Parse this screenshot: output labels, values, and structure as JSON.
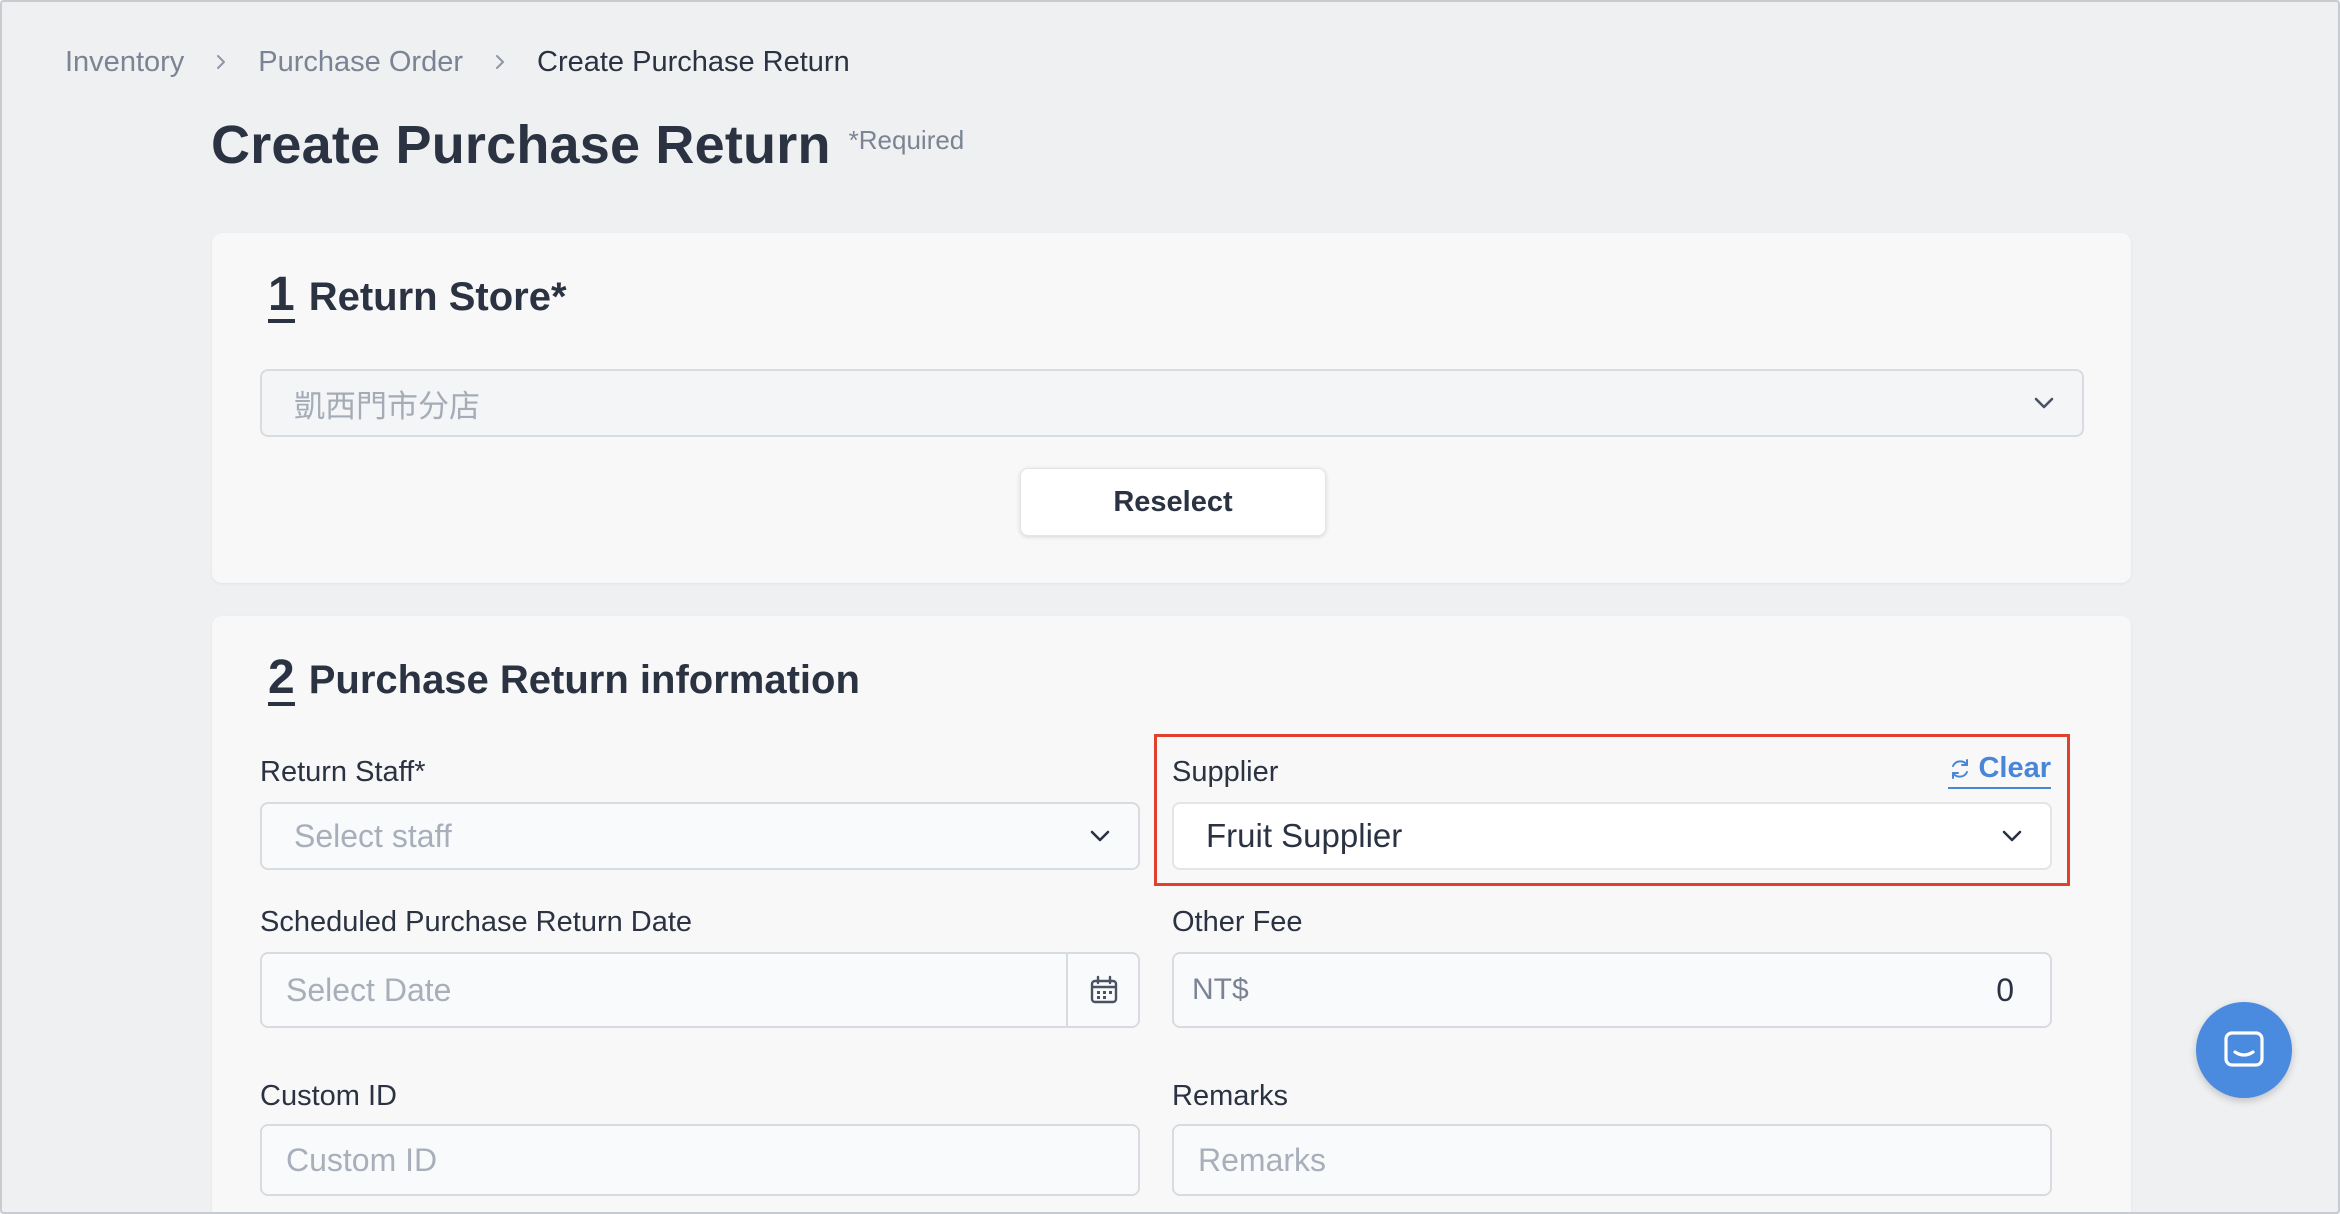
{
  "breadcrumb": {
    "items": [
      "Inventory",
      "Purchase Order",
      "Create Purchase Return"
    ]
  },
  "header": {
    "title": "Create Purchase Return",
    "required_note": "*Required"
  },
  "section1": {
    "number": "1",
    "title": "Return Store*",
    "store_select": {
      "value": "凱西門市分店"
    },
    "reselect_label": "Reselect"
  },
  "section2": {
    "number": "2",
    "title": "Purchase Return information",
    "return_staff": {
      "label": "Return Staff*",
      "placeholder": "Select staff"
    },
    "supplier": {
      "label": "Supplier",
      "clear_label": "Clear",
      "value": "Fruit Supplier"
    },
    "scheduled_date": {
      "label": "Scheduled Purchase Return Date",
      "placeholder": "Select Date"
    },
    "other_fee": {
      "label": "Other Fee",
      "prefix": "NT$",
      "value": "0"
    },
    "custom_id": {
      "label": "Custom ID",
      "placeholder": "Custom ID"
    },
    "remarks": {
      "label": "Remarks",
      "placeholder": "Remarks"
    }
  },
  "colors": {
    "accent": "#4a86d8",
    "highlight": "#e0412f",
    "text": "#2b3342",
    "muted": "#7b8494"
  },
  "icons": {
    "breadcrumb_separator": "chevron-right-icon",
    "select_caret": "chevron-down-icon",
    "clear": "refresh-icon",
    "date": "calendar-icon",
    "chat": "chat-icon"
  }
}
